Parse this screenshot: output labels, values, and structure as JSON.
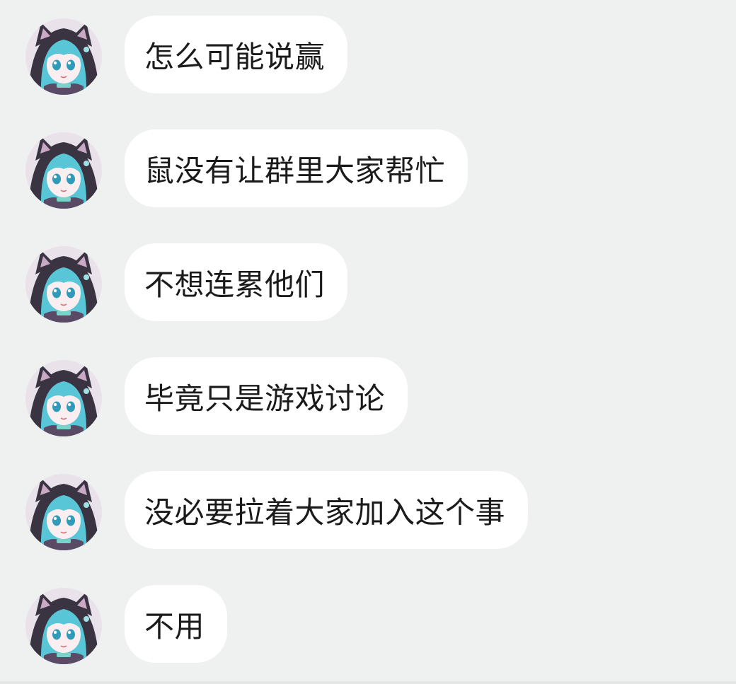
{
  "chat": {
    "messages": [
      {
        "text": "怎么可能说赢",
        "avatar": "anime-girl-hood-avatar"
      },
      {
        "text": "鼠没有让群里大家帮忙",
        "avatar": "anime-girl-hood-avatar"
      },
      {
        "text": "不想连累他们",
        "avatar": "anime-girl-hood-avatar"
      },
      {
        "text": "毕竟只是游戏讨论",
        "avatar": "anime-girl-hood-avatar"
      },
      {
        "text": "没必要拉着大家加入这个事",
        "avatar": "anime-girl-hood-avatar"
      },
      {
        "text": "不用",
        "avatar": "anime-girl-hood-avatar"
      }
    ]
  },
  "colors": {
    "background": "#eff0f0",
    "bubble": "#ffffff",
    "text": "#1b1b1b",
    "hair": "#58c6d6",
    "hood": "#3a3442"
  }
}
